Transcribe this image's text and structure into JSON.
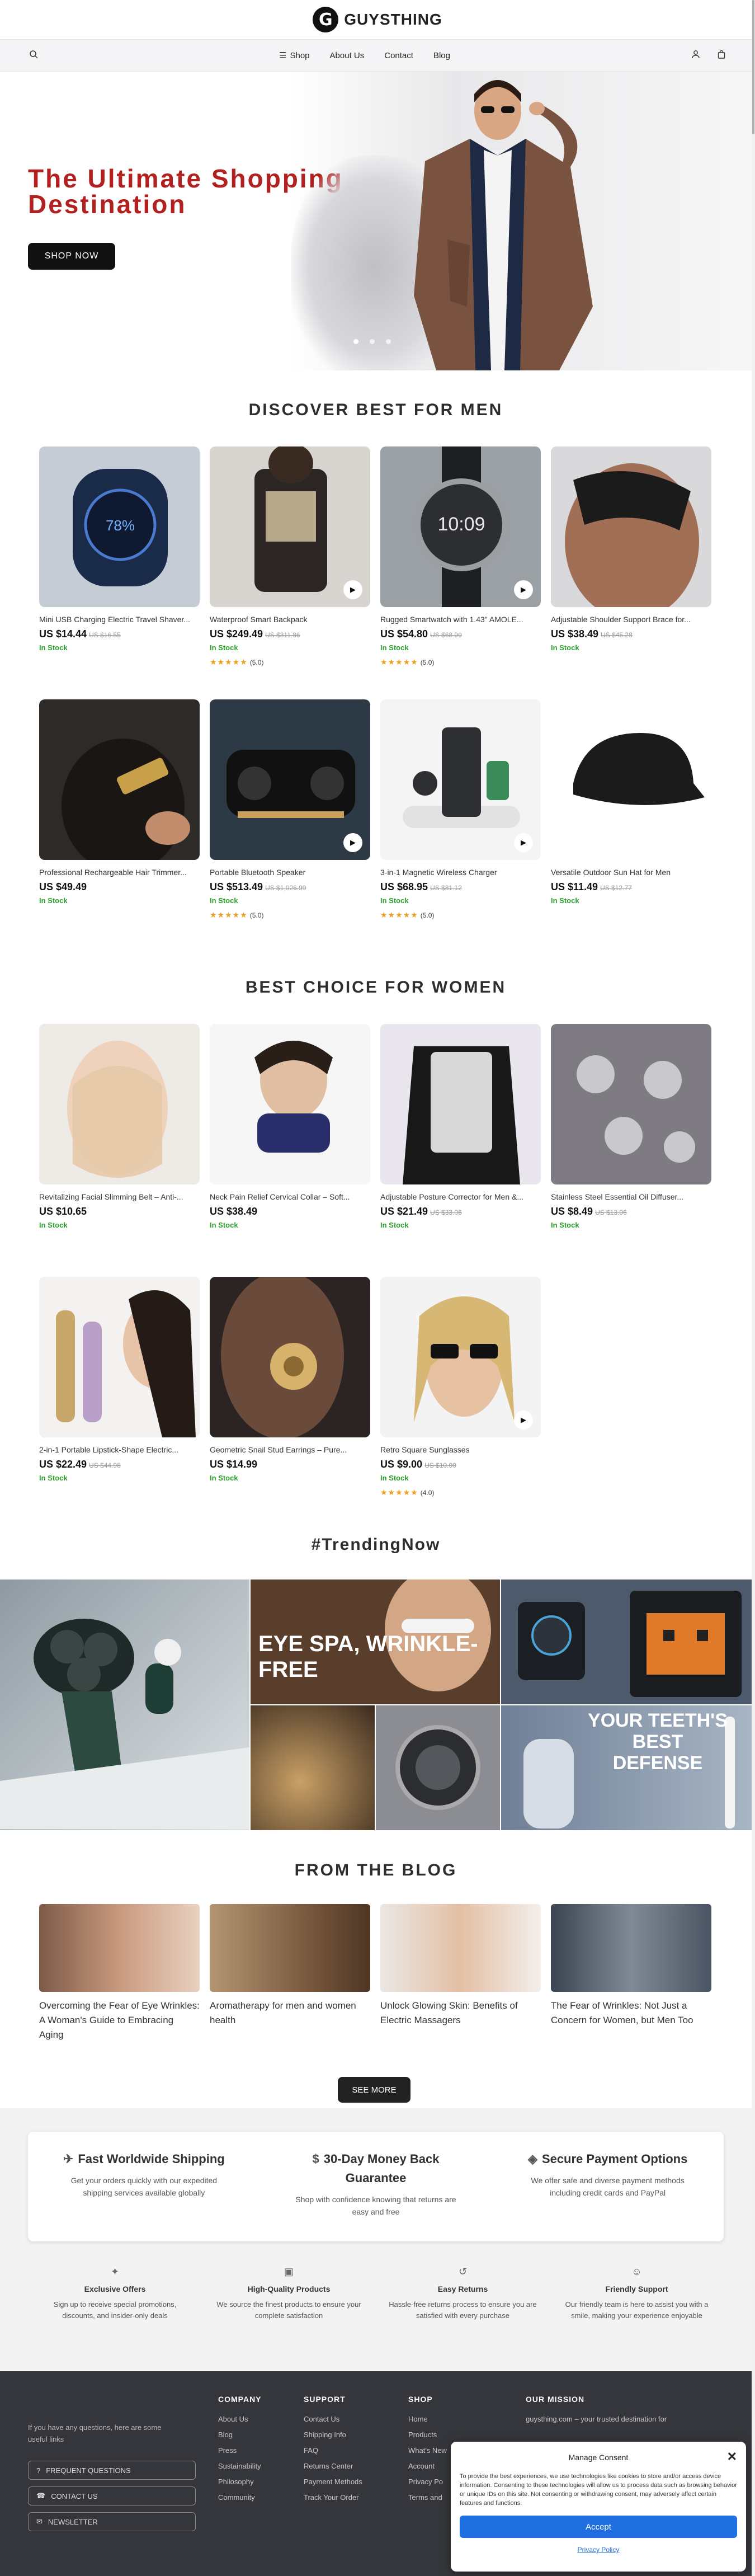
{
  "brand": {
    "name": "GUYSTHING"
  },
  "nav": {
    "shop": "Shop",
    "about": "About Us",
    "contact": "Contact",
    "blog": "Blog"
  },
  "hero": {
    "title": "The Ultimate Shopping Destination",
    "button": "SHOP NOW"
  },
  "men": {
    "title": "DISCOVER BEST FOR MEN",
    "products": [
      {
        "name": "Mini USB Charging Electric Travel Shaver...",
        "price": "US $14.44",
        "old": "US $16.55",
        "stock": "In Stock",
        "rating": "",
        "video": false
      },
      {
        "name": "Waterproof Smart Backpack",
        "price": "US $249.49",
        "old": "US $311.86",
        "stock": "In Stock",
        "rating": "(5.0)",
        "video": true
      },
      {
        "name": "Rugged Smartwatch with 1.43\" AMOLE...",
        "price": "US $54.80",
        "old": "US $68.99",
        "stock": "In Stock",
        "rating": "(5.0)",
        "video": true
      },
      {
        "name": "Adjustable Shoulder Support Brace for...",
        "price": "US $38.49",
        "old": "US $45.28",
        "stock": "In Stock",
        "rating": "",
        "video": false
      },
      {
        "name": "Professional Rechargeable Hair Trimmer...",
        "price": "US $49.49",
        "old": "",
        "stock": "In Stock",
        "rating": "",
        "video": false
      },
      {
        "name": "Portable Bluetooth Speaker",
        "price": "US $513.49",
        "old": "US $1,026.99",
        "stock": "In Stock",
        "rating": "(5.0)",
        "video": true
      },
      {
        "name": "3-in-1 Magnetic Wireless Charger",
        "price": "US $68.95",
        "old": "US $81.12",
        "stock": "In Stock",
        "rating": "(5.0)",
        "video": true
      },
      {
        "name": "Versatile Outdoor Sun Hat for Men",
        "price": "US $11.49",
        "old": "US $12.77",
        "stock": "In Stock",
        "rating": "",
        "video": false
      }
    ]
  },
  "women": {
    "title": "BEST CHOICE FOR WOMEN",
    "products": [
      {
        "name": "Revitalizing Facial Slimming Belt – Anti-...",
        "price": "US $10.65",
        "old": "",
        "stock": "In Stock",
        "rating": "",
        "video": false
      },
      {
        "name": "Neck Pain Relief Cervical Collar – Soft...",
        "price": "US $38.49",
        "old": "",
        "stock": "In Stock",
        "rating": "",
        "video": false
      },
      {
        "name": "Adjustable Posture Corrector for Men &...",
        "price": "US $21.49",
        "old": "US $33.06",
        "stock": "In Stock",
        "rating": "",
        "video": false
      },
      {
        "name": "Stainless Steel Essential Oil Diffuser...",
        "price": "US $8.49",
        "old": "US $13.06",
        "stock": "In Stock",
        "rating": "",
        "video": false
      },
      {
        "name": "2-in-1 Portable Lipstick-Shape Electric...",
        "price": "US $22.49",
        "old": "US $44.98",
        "stock": "In Stock",
        "rating": "",
        "video": false
      },
      {
        "name": "Geometric Snail Stud Earrings – Pure...",
        "price": "US $14.99",
        "old": "",
        "stock": "In Stock",
        "rating": "",
        "video": false
      },
      {
        "name": "Retro Square Sunglasses",
        "price": "US $9.00",
        "old": "US $10.00",
        "stock": "In Stock",
        "rating": "(4.0)",
        "video": true
      }
    ]
  },
  "trending": {
    "title": "#TrendingNow",
    "eye_spa": "EYE SPA, WRINKLE-FREE",
    "teeth": "YOUR TEETH'S BEST DEFENSE"
  },
  "blog": {
    "title": "FROM THE BLOG",
    "posts": [
      "Overcoming the Fear of Eye Wrinkles: A Woman's Guide to Embracing Aging",
      "Aromatherapy for men and women health",
      "Unlock Glowing Skin: Benefits of Electric Massagers",
      "The Fear of Wrinkles: Not Just a Concern for Women, but Men Too"
    ],
    "see_more": "SEE MORE"
  },
  "features": [
    {
      "title": "Fast Worldwide Shipping",
      "text": "Get your orders quickly with our expedited shipping services available globally"
    },
    {
      "title": "30-Day Money Back Guarantee",
      "text": "Shop with confidence knowing that returns are easy and free"
    },
    {
      "title": "Secure Payment Options",
      "text": "We offer safe and diverse payment methods including credit cards and PayPal"
    }
  ],
  "perks": [
    {
      "title": "Exclusive Offers",
      "text": "Sign up to receive special promotions, discounts, and insider-only deals"
    },
    {
      "title": "High-Quality Products",
      "text": "We source the finest products to ensure your complete satisfaction"
    },
    {
      "title": "Easy Returns",
      "text": "Hassle-free returns process to ensure you are satisfied with every purchase"
    },
    {
      "title": "Friendly Support",
      "text": "Our friendly team is here to assist you with a smile, making your experience enjoyable"
    }
  ],
  "footer": {
    "intro": "If you have any questions, here are some useful links",
    "faq": "FREQUENT QUESTIONS",
    "contact": "CONTACT US",
    "newsletter": "NEWSLETTER",
    "company": {
      "title": "COMPANY",
      "links": [
        "About Us",
        "Blog",
        "Press",
        "Sustainability",
        "Philosophy",
        "Community"
      ]
    },
    "support": {
      "title": "SUPPORT",
      "links": [
        "Contact Us",
        "Shipping Info",
        "FAQ",
        "Returns Center",
        "Payment Methods",
        "Track Your Order"
      ]
    },
    "shop": {
      "title": "SHOP",
      "links": [
        "Home",
        "Products",
        "What's New",
        "Account",
        "Privacy Po",
        "Terms and"
      ]
    },
    "mission": {
      "title": "OUR MISSION",
      "text": "guysthing.com – your trusted destination for"
    }
  },
  "consent": {
    "title": "Manage Consent",
    "text": "To provide the best experiences, we use technologies like cookies to store and/or access device information. Consenting to these technologies will allow us to process data such as browsing behavior or unique IDs on this site. Not consenting or withdrawing consent, may adversely affect certain features and functions.",
    "accept": "Accept",
    "policy": "Privacy Policy"
  }
}
